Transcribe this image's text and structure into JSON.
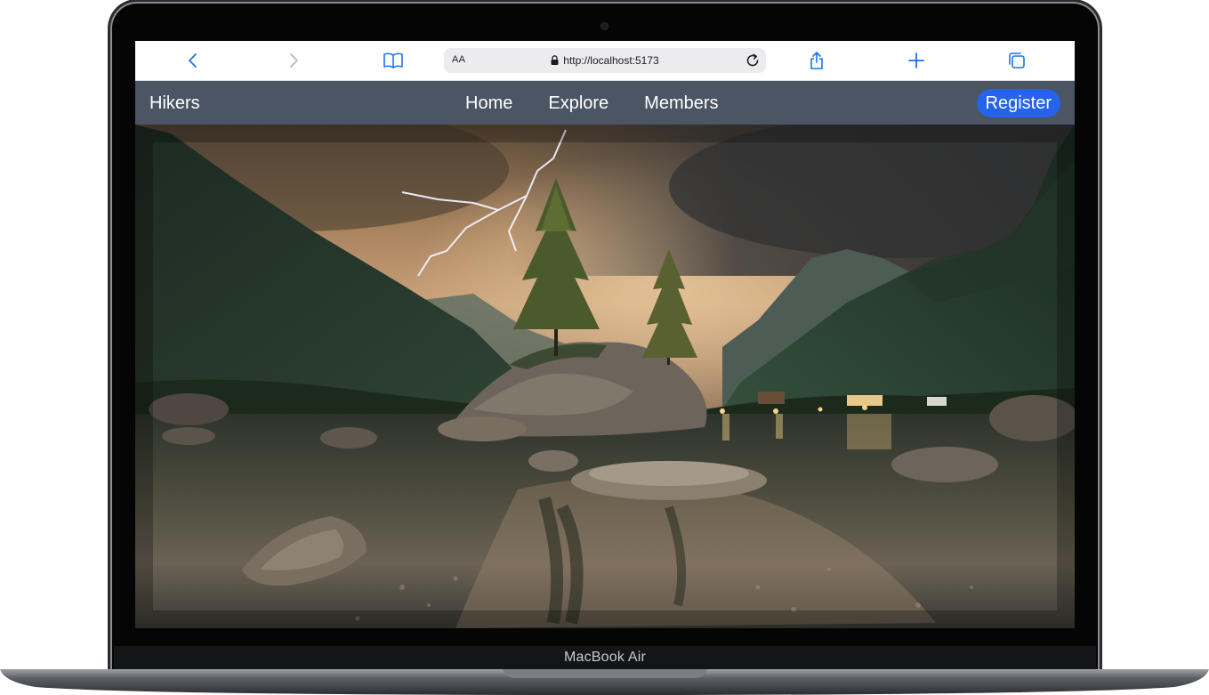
{
  "device": {
    "label": "MacBook Air"
  },
  "browser": {
    "address_bar": {
      "reader_label": "AA",
      "url": "http://localhost:5173"
    },
    "icons": {
      "back": "chevron-left-icon",
      "forward": "chevron-right-icon",
      "bookmarks": "book-icon",
      "lock": "lock-icon",
      "reload": "reload-icon",
      "share": "share-icon",
      "new_tab": "plus-icon",
      "tabs": "tabs-icon"
    },
    "accent_color": "#1a73e8"
  },
  "app": {
    "brand": "Hikers",
    "nav": [
      {
        "label": "Home"
      },
      {
        "label": "Explore"
      },
      {
        "label": "Members"
      }
    ],
    "register_label": "Register",
    "colors": {
      "nav_background": "#4b5563",
      "register_button": "#2563eb"
    }
  },
  "hero": {
    "icon": "landscape-photo"
  }
}
